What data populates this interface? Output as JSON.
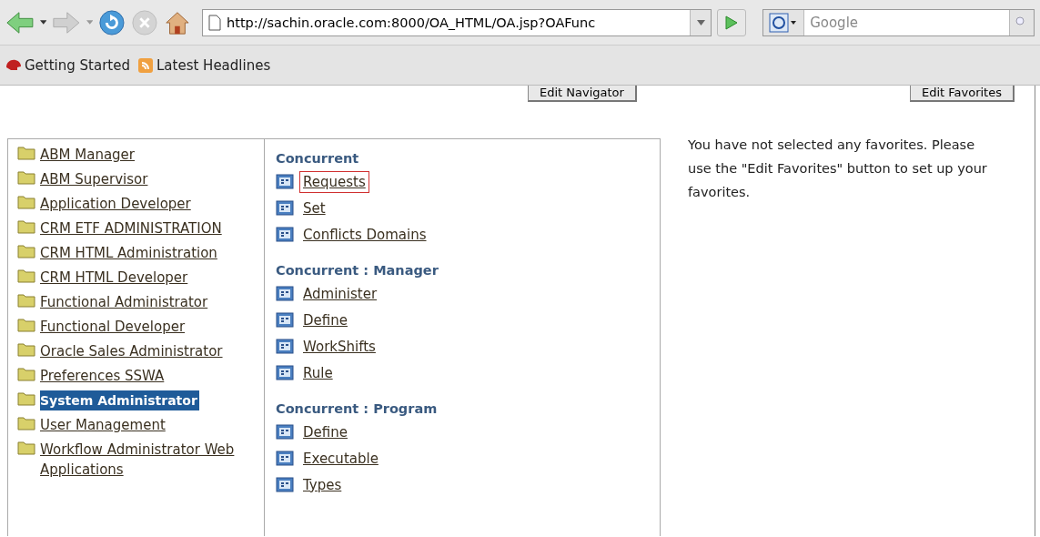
{
  "toolbar": {
    "url": "http://sachin.oracle.com:8000/OA_HTML/OA.jsp?OAFunc",
    "search_placeholder": "Google"
  },
  "bookmarks": [
    "Getting Started",
    "Latest Headlines"
  ],
  "buttons": [
    "Edit Navigator",
    "Edit Favorites"
  ],
  "responsibilities": [
    {
      "label": "ABM Manager",
      "selected": false
    },
    {
      "label": "ABM Supervisor",
      "selected": false
    },
    {
      "label": "Application Developer",
      "selected": false
    },
    {
      "label": "CRM ETF ADMINISTRATION",
      "selected": false
    },
    {
      "label": "CRM HTML Administration",
      "selected": false
    },
    {
      "label": "CRM HTML Developer",
      "selected": false
    },
    {
      "label": "Functional Administrator",
      "selected": false
    },
    {
      "label": "Functional Developer",
      "selected": false
    },
    {
      "label": "Oracle Sales Administrator",
      "selected": false
    },
    {
      "label": "Preferences SSWA",
      "selected": false
    },
    {
      "label": "System Administrator",
      "selected": true
    },
    {
      "label": "User Management",
      "selected": false
    },
    {
      "label": "Workflow Administrator Web Applications",
      "selected": false
    }
  ],
  "functions": [
    {
      "heading": "Concurrent",
      "items": [
        {
          "label": "Requests",
          "highlighted": true
        },
        {
          "label": "Set",
          "highlighted": false
        },
        {
          "label": "Conflicts Domains",
          "highlighted": false
        }
      ]
    },
    {
      "heading": "Concurrent : Manager",
      "items": [
        {
          "label": "Administer",
          "highlighted": false
        },
        {
          "label": "Define",
          "highlighted": false
        },
        {
          "label": "WorkShifts",
          "highlighted": false
        },
        {
          "label": "Rule",
          "highlighted": false
        }
      ]
    },
    {
      "heading": "Concurrent : Program",
      "items": [
        {
          "label": "Define",
          "highlighted": false
        },
        {
          "label": "Executable",
          "highlighted": false
        },
        {
          "label": "Types",
          "highlighted": false
        }
      ]
    }
  ],
  "favorites_message": "You have not selected any favorites. Please use the \"Edit Favorites\" button to set up your favorites."
}
